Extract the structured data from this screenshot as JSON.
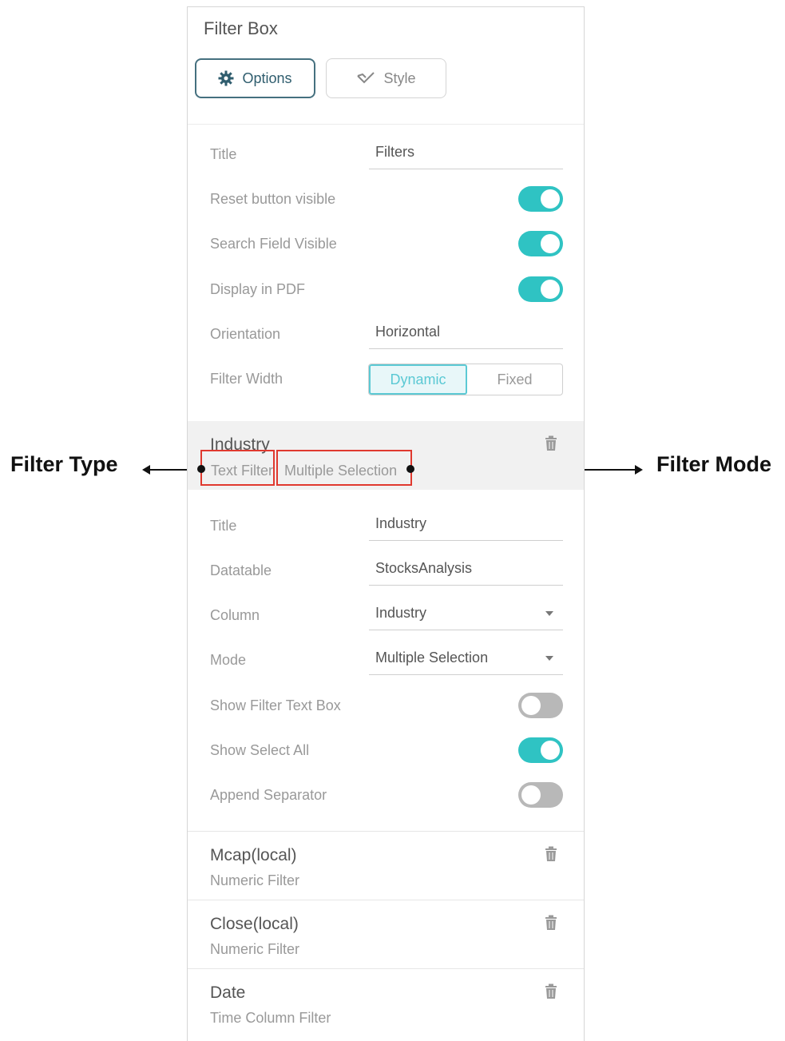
{
  "panel": {
    "title": "Filter Box"
  },
  "tabs": {
    "options": "Options",
    "style": "Style"
  },
  "settings": {
    "title_label": "Title",
    "title_value": "Filters",
    "reset_label": "Reset button visible",
    "reset_on": true,
    "search_label": "Search Field Visible",
    "search_on": true,
    "pdf_label": "Display in PDF",
    "pdf_on": true,
    "orientation_label": "Orientation",
    "orientation_value": "Horizontal",
    "width_label": "Filter Width",
    "width_options": [
      "Dynamic",
      "Fixed"
    ],
    "width_selected": "Dynamic"
  },
  "industry": {
    "name": "Industry",
    "type": "Text Filter",
    "mode_text": "Multiple Selection",
    "title_label": "Title",
    "title_value": "Industry",
    "datatable_label": "Datatable",
    "datatable_value": "StocksAnalysis",
    "column_label": "Column",
    "column_value": "Industry",
    "mode_label": "Mode",
    "mode_value": "Multiple Selection",
    "show_text_box_label": "Show Filter Text Box",
    "show_text_box_on": false,
    "show_select_all_label": "Show Select All",
    "show_select_all_on": true,
    "append_separator_label": "Append Separator",
    "append_separator_on": false
  },
  "filters": [
    {
      "name": "Mcap(local)",
      "type": "Numeric Filter"
    },
    {
      "name": "Close(local)",
      "type": "Numeric Filter"
    },
    {
      "name": "Date",
      "type": "Time Column Filter"
    }
  ],
  "annotations": {
    "left": "Filter Type",
    "right": "Filter Mode"
  },
  "colors": {
    "accent": "#2fc3c3",
    "highlight": "#e0392f",
    "tab_border": "#45707f"
  },
  "icons": {
    "options": "gear-icon",
    "style": "brush-icon",
    "delete": "trash-icon",
    "dropdown": "caret-down-icon"
  }
}
